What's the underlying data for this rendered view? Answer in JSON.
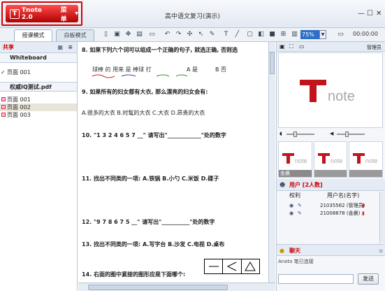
{
  "window": {
    "title": "高中语文复习(演示)",
    "logo_text": "Tnote 2.0",
    "logo_menu": "菜单"
  },
  "toolbar": {
    "tabs": [
      "授课模式",
      "白板模式"
    ],
    "zoom_value": "75%",
    "timer": "00:00:00"
  },
  "left": {
    "share_label": "共享",
    "whiteboard_label": "Whiteboard",
    "whiteboard_items": [
      "页面 001"
    ],
    "pdf_label": "权威IQ测试.pdf",
    "pdf_items": [
      "页面 001",
      "页面 002",
      "页面 003"
    ]
  },
  "content": {
    "q8": "8. 如果下列六个词可以组成一个正确的句子, 就选正确, 否则选",
    "q8_line": "球棒 的 用来 是 棒球 打",
    "q8_a": "A 是",
    "q8_b": "B 否",
    "q9": "9. 如果所有的妇女都有大衣, 那么漂亮的妇女会有:",
    "q9_opts": "A.很多的大衣   B.时髦的大衣   C.大衣   D.昂贵的大衣",
    "q10": "10. \"1 3 2 4 6 5 7 __\" 请写出\"____________\"处的数字",
    "q11": "11. 找出不同类的一项: A.铁锅  B.小勺  C.米饭  D.碟子",
    "q12": "12. \"9 7 8 6 7 5 __\" 请写出\"__________\"处的数字",
    "q13": "13. 找出不同类的一项: A.写字台 B.沙发 C.电视 D.桌布",
    "q14": "14. 右面的图中紧接的图形应是下面哪个:"
  },
  "right": {
    "admin_label": "管理员",
    "thumb_caption": "金晨",
    "users_title": "用户 [2人数]",
    "col_perm": "权利",
    "col_name": "用户名(名字)",
    "users": [
      {
        "name": "21035562 (管理员)"
      },
      {
        "name": "21008878 (金晨)"
      }
    ],
    "chat_title": "聊天",
    "chat_msg": "Anoto 笔已连接",
    "send_label": "发送"
  }
}
